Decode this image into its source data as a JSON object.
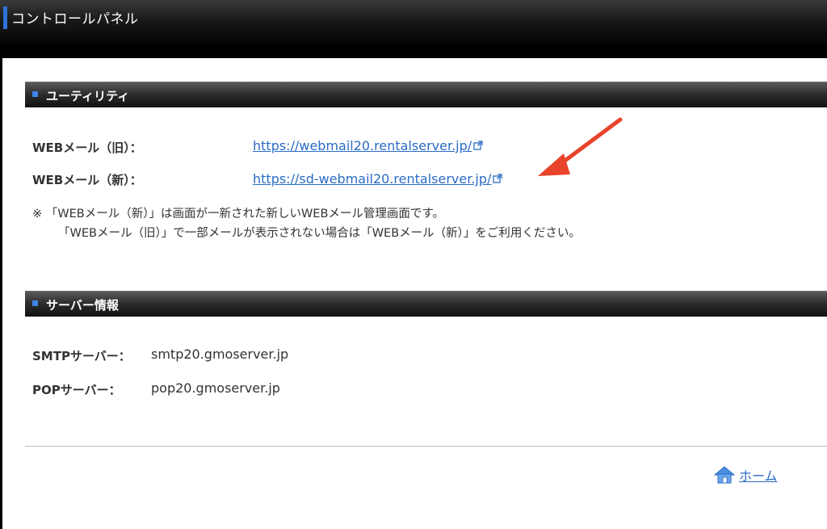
{
  "header": {
    "title": "コントロールパネル"
  },
  "utility": {
    "title": "ユーティリティ",
    "rows": [
      {
        "label": "WEBメール（旧）：",
        "link": "https://webmail20.rentalserver.jp/"
      },
      {
        "label": "WEBメール（新）：",
        "link": "https://sd-webmail20.rentalserver.jp/"
      }
    ],
    "note_line1": "※ 「WEBメール（新）」は画面が一新された新しいWEBメール管理画面です。",
    "note_line2": "「WEBメール（旧）」で一部メールが表示されない場合は「WEBメール（新）」をご利用ください。"
  },
  "server_info": {
    "title": "サーバー情報",
    "rows": [
      {
        "label": "SMTPサーバー：",
        "value": "smtp20.gmoserver.jp"
      },
      {
        "label": "POPサーバー：",
        "value": "pop20.gmoserver.jp"
      }
    ]
  },
  "footer": {
    "home_label": "ホーム"
  },
  "icons": {
    "external": "external-link-icon",
    "home": "home-icon",
    "annotation": "red-arrow"
  },
  "colors": {
    "link": "#2a6cc6",
    "accent": "#2f73d8",
    "arrow": "#e8432b"
  }
}
